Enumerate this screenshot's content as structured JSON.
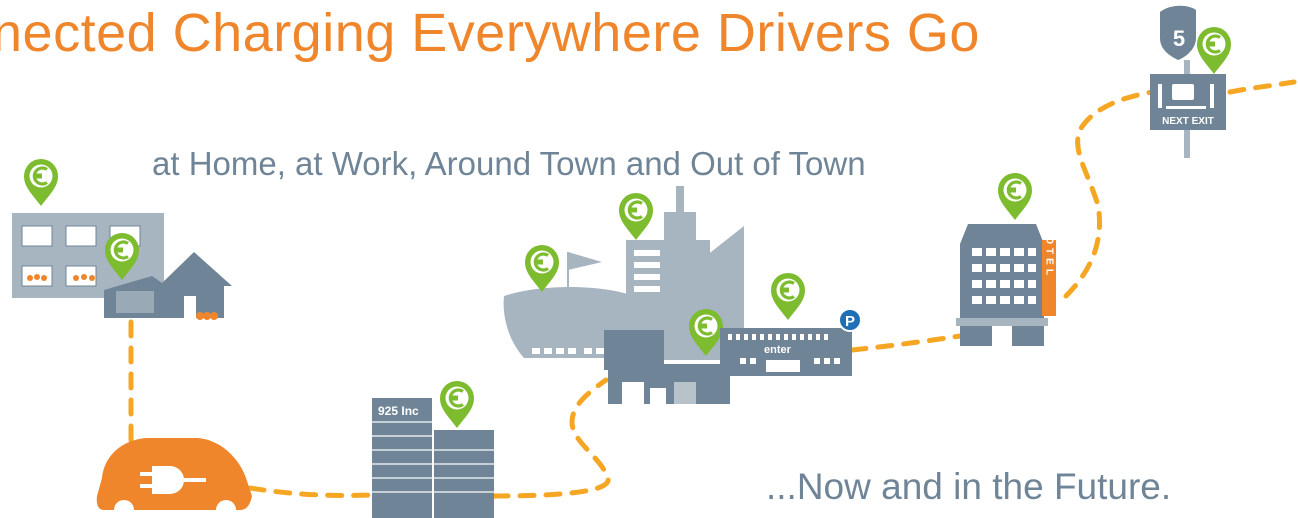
{
  "headline": {
    "title": "nected Charging Everywhere Drivers Go",
    "subtitle": "at Home, at Work, Around Town and Out of Town",
    "tagline": "...Now and in the Future."
  },
  "signs": {
    "interstate_number": "5",
    "exit_sign": "NEXT EXIT",
    "office_sign": "925 Inc",
    "mall_sign": "enter",
    "parking": "P",
    "hotel": "HOTEL"
  },
  "colors": {
    "orange": "#f0862b",
    "building_gray": "#6f8597",
    "light_gray": "#a7b5c1",
    "pin_green": "#7dbb2f",
    "route_orange": "#f5a623"
  },
  "icons": {
    "charger_pin": "charging-pin-icon",
    "car": "electric-car-icon",
    "parking": "parking-icon"
  }
}
